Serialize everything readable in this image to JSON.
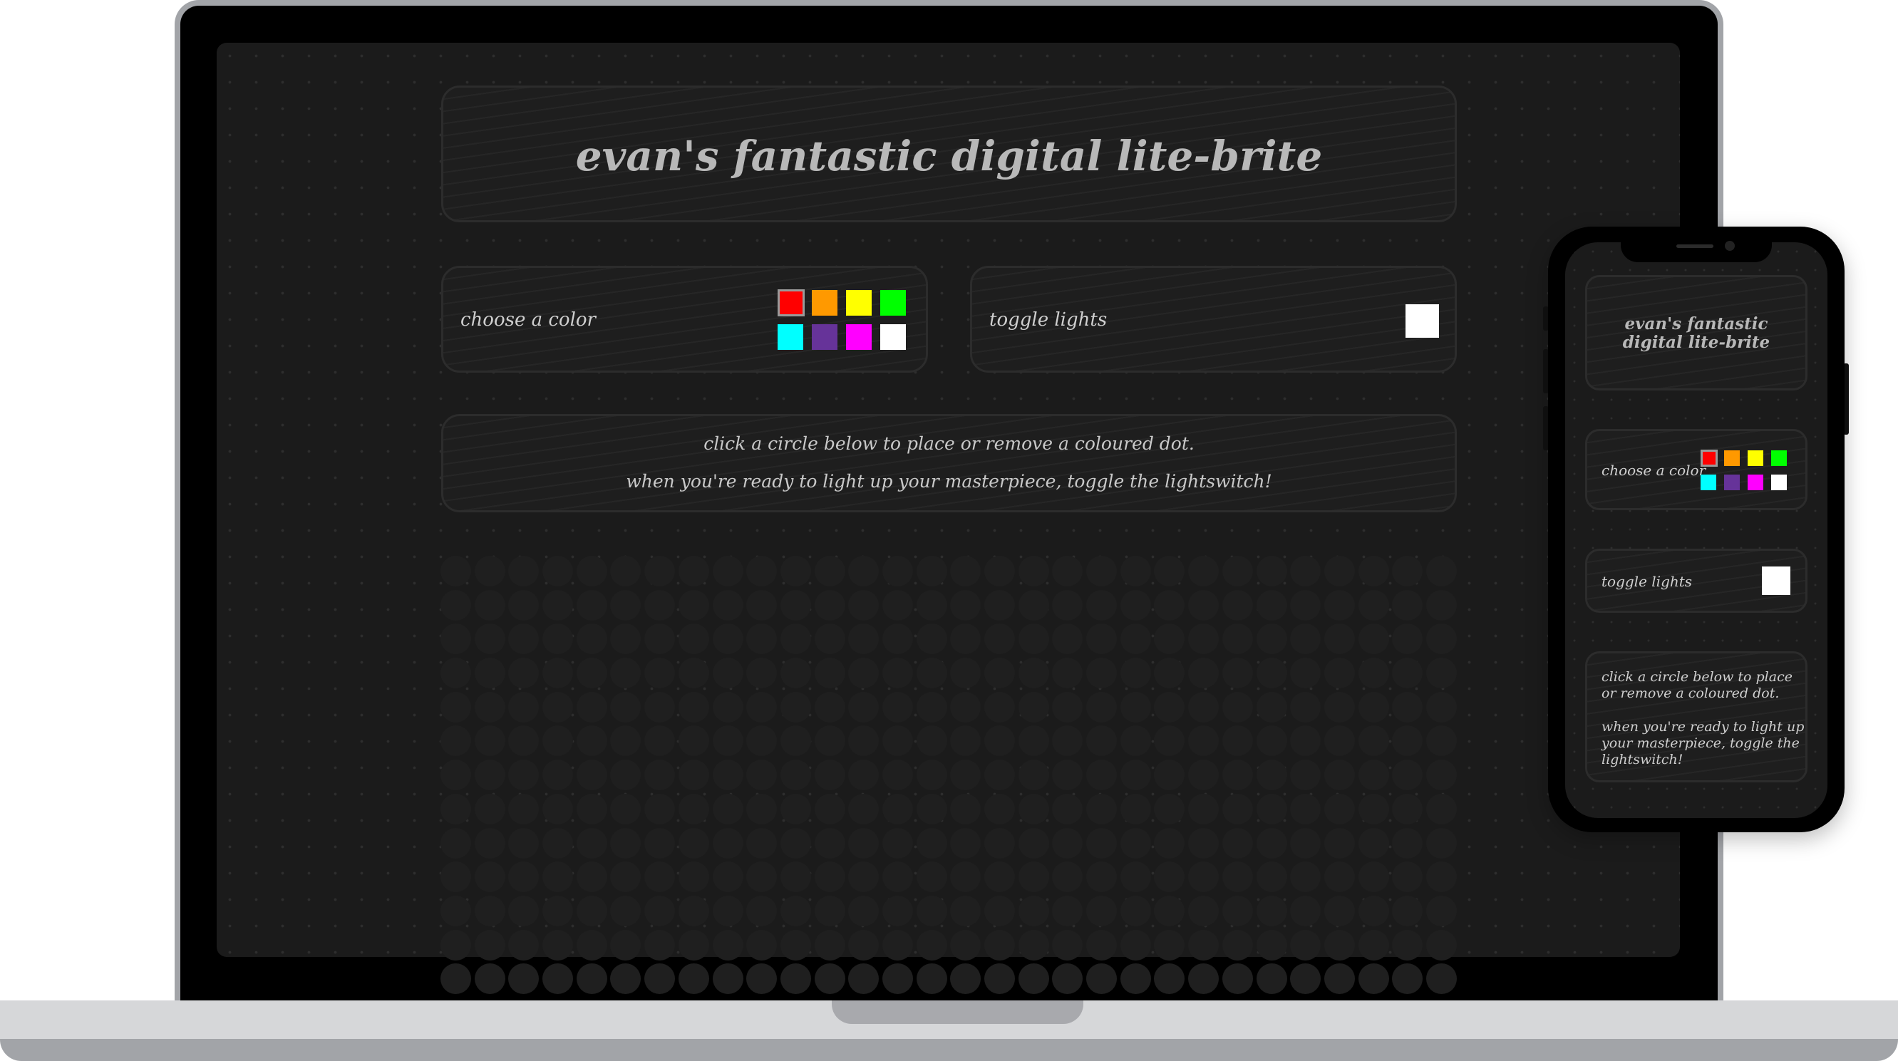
{
  "app": {
    "title": "evan's fantastic digital lite-brite"
  },
  "controls": {
    "color_label": "choose a color",
    "toggle_label": "toggle lights",
    "colors": [
      "#ff0000",
      "#ff9900",
      "#ffff00",
      "#00ff00",
      "#00ffff",
      "#663399",
      "#ff00ff",
      "#ffffff"
    ],
    "selected_color_index": 0
  },
  "instructions": {
    "line1": "click a circle below to place or remove a coloured dot.",
    "line2": "when you're ready to light up your masterpiece, toggle the lightswitch!"
  },
  "mobile": {
    "title_line1": "evan's fantastic",
    "title_line2": "digital lite-brite",
    "color_label": "choose a color",
    "toggle_label": "toggle lights",
    "instr_a1": "click a circle below to place",
    "instr_a2": "or remove a coloured dot.",
    "instr_b1": "when you're ready to light up",
    "instr_b2": "your masterpiece, toggle the",
    "instr_b3": "lightswitch!"
  }
}
